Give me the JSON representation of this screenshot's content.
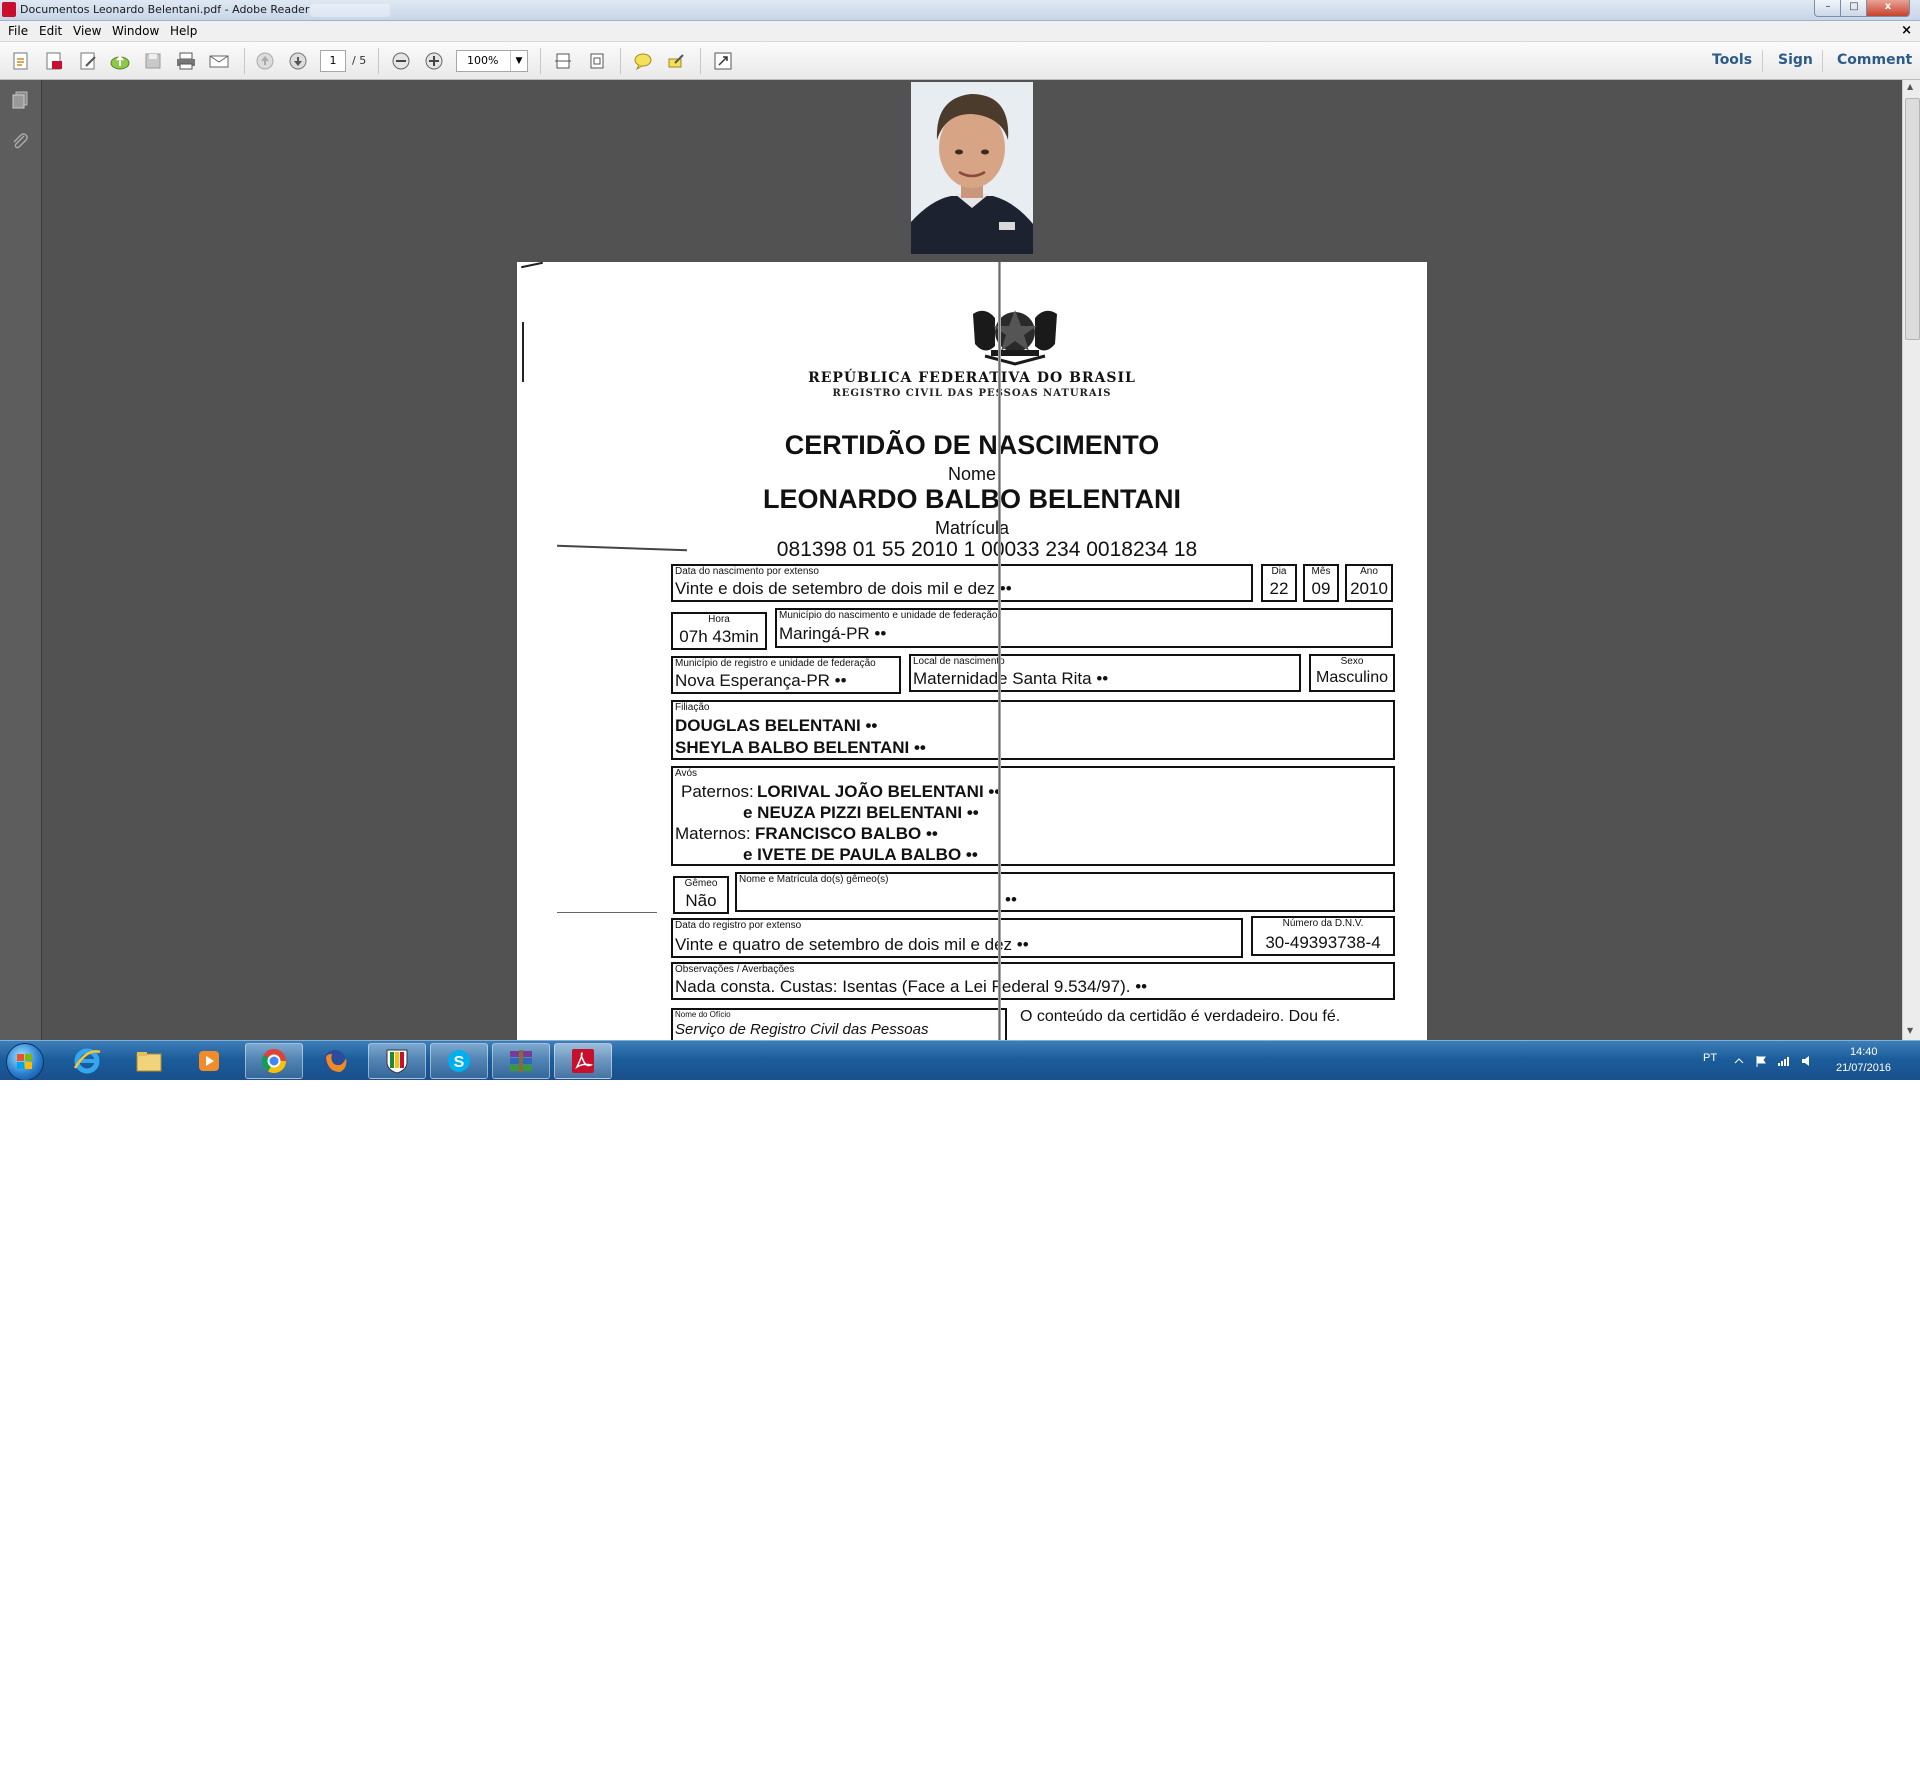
{
  "window": {
    "title": "Documentos Leonardo Belentani.pdf - Adobe Reader",
    "buttons": {
      "minimize": "–",
      "maximize": "□",
      "close": "x"
    }
  },
  "menu": {
    "items": [
      "File",
      "Edit",
      "View",
      "Window",
      "Help"
    ],
    "close_doc": "×"
  },
  "toolbar": {
    "current_page": "1",
    "total_pages": "/ 5",
    "zoom": "100%",
    "links": [
      "Tools",
      "Sign",
      "Comment"
    ]
  },
  "certificate": {
    "header_line1": "REPÚBLICA FEDERATIVA DO BRASIL",
    "header_line2": "REGISTRO CIVIL DAS PESSOAS NATURAIS",
    "title": "CERTIDÃO DE NASCIMENTO",
    "name_label": "Nome",
    "name": "LEONARDO BALBO BELENTANI",
    "matricula_label": "Matrícula",
    "matricula": "081398 01 55 2010 1 00033 234 0018234 18",
    "birth_date_label": "Data do nascimento por extenso",
    "birth_date_text": "Vinte e dois de setembro de dois mil e dez ••",
    "day_label": "Dia",
    "day": "22",
    "month_label": "Mês",
    "month": "09",
    "year_label": "Ano",
    "year": "2010",
    "hour_label": "Hora",
    "hour": "07h 43min",
    "birth_city_label": "Município do nascimento e unidade de federação",
    "birth_city": "Maringá-PR ••",
    "reg_city_label": "Município de registro e unidade de federação",
    "reg_city": "Nova Esperança-PR ••",
    "birth_place_label": "Local de nascimento",
    "birth_place": "Maternidade Santa Rita ••",
    "sex_label": "Sexo",
    "sex": "Masculino",
    "filiation_label": "Filiação",
    "father": "DOUGLAS BELENTANI ••",
    "mother": "SHEYLA BALBO BELENTANI ••",
    "grandparents_label": "Avós",
    "paternal_label": "Paternos:",
    "paternal_1": "LORIVAL JOÃO BELENTANI ••",
    "paternal_2": "e NEUZA PIZZI BELENTANI ••",
    "maternal_label": "Maternos:",
    "maternal_1": "FRANCISCO BALBO ••",
    "maternal_2": "e IVETE DE PAULA BALBO ••",
    "twin_label": "Gêmeo",
    "twin": "Não",
    "twin_names_label": "Nome e Matrícula do(s) gêmeo(s)",
    "twin_names": "••",
    "reg_date_label": "Data do registro por extenso",
    "reg_date_text": "Vinte e quatro de setembro de dois mil e dez ••",
    "dnv_label": "Número da D.N.V.",
    "dnv": "30-49393738-4",
    "obs_label": "Observações / Averbações",
    "obs": "Nada consta. Custas: Isentas (Face a Lei Federal 9.534/97). ••",
    "office_label": "Nome do Ofício",
    "office": "Serviço de Registro Civil das Pessoas",
    "attestation": "O conteúdo da certidão é verdadeiro. Dou fé."
  },
  "taskbar": {
    "apps": [
      "internet-explorer",
      "file-explorer",
      "media-player",
      "chrome",
      "firefox",
      "app-shield",
      "skype",
      "winrar",
      "adobe-reader"
    ],
    "language": "PT",
    "time": "14:40",
    "date": "21/07/2016"
  }
}
